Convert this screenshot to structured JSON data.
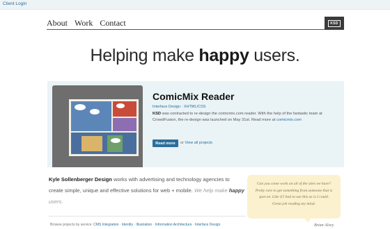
{
  "topbar": {
    "client_login": "Client Login"
  },
  "nav": {
    "about": "About",
    "work": "Work",
    "contact": "Contact"
  },
  "logo": {
    "text": "KSD"
  },
  "hero": {
    "before": "Helping make ",
    "emphasis": "happy",
    "after": " users."
  },
  "feature": {
    "title": "ComicMix Reader",
    "tags": "Interface Design · XHTML/CSS",
    "desc_company": "KSD",
    "desc_body": " was contracted to re-design the comicmix.com reader. With the help of the fantastic team at CrowdFusion, the re-design was launched on May 31st. Read more at ",
    "desc_link": "comicmix.com",
    "read_more": "Read more",
    "or_text": "or ",
    "view_all": "View all projects"
  },
  "intro": {
    "name": "Kyle Sollenberger Design",
    "body": " works with advertising and technology agencies to create simple, unique and effective solutions for web + mobile. ",
    "tag_before": "We help make ",
    "tag_emphasis": "happy",
    "tag_after": " users."
  },
  "browse": {
    "label": "Browse projects by service:",
    "services": [
      "CMS Integration",
      "Identity",
      "Illustration",
      "Information Architecture",
      "Interface Design"
    ]
  },
  "testimonial": {
    "quote": "Can you come work on all of the sites we have? Pretty rare to get something from someone that is spot on. Like if I had to use this as is I could. Great job reading my mind.",
    "author": "Brian Alvey"
  },
  "colors": {
    "accent": "#2d6f9c",
    "panel_bg": "#eaf3f6",
    "quote_bg": "#fbf1cf"
  }
}
